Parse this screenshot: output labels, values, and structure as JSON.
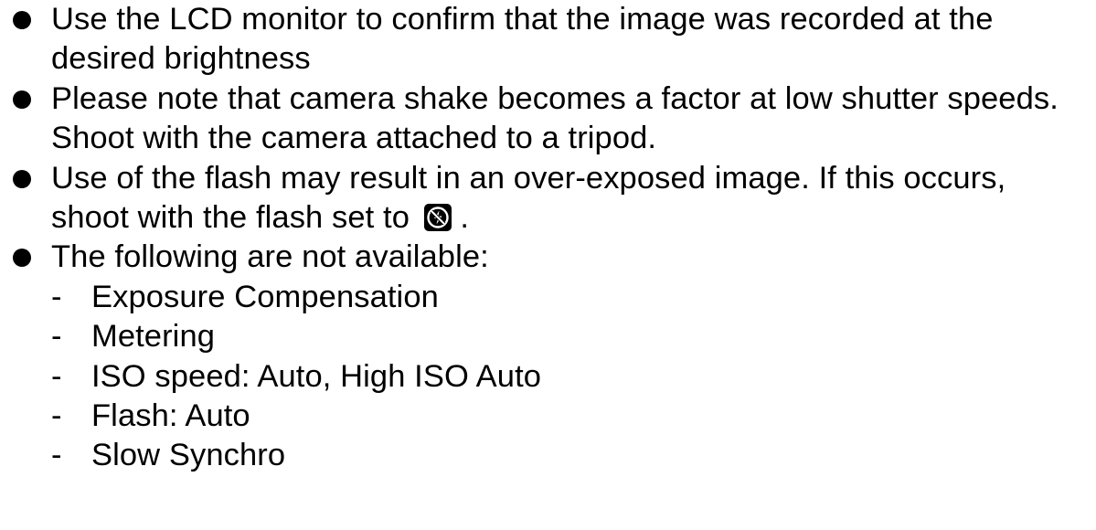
{
  "bullets": [
    {
      "text": "Use the LCD monitor to confirm that the image was recorded at the desired brightness"
    },
    {
      "text": "Please note that camera shake becomes a factor at low shutter speeds. Shoot with the camera attached to a tripod."
    },
    {
      "text": "Use of the flash may result in an over-exposed image. If this occurs, shoot with the flash set to",
      "icon": "flash-off-icon",
      "suffix": "."
    },
    {
      "text": "The following are not available:",
      "sub_items": [
        "Exposure Compensation",
        "Metering",
        "ISO speed: Auto, High ISO Auto",
        "Flash: Auto",
        "Slow Synchro"
      ]
    }
  ],
  "dash": "-"
}
